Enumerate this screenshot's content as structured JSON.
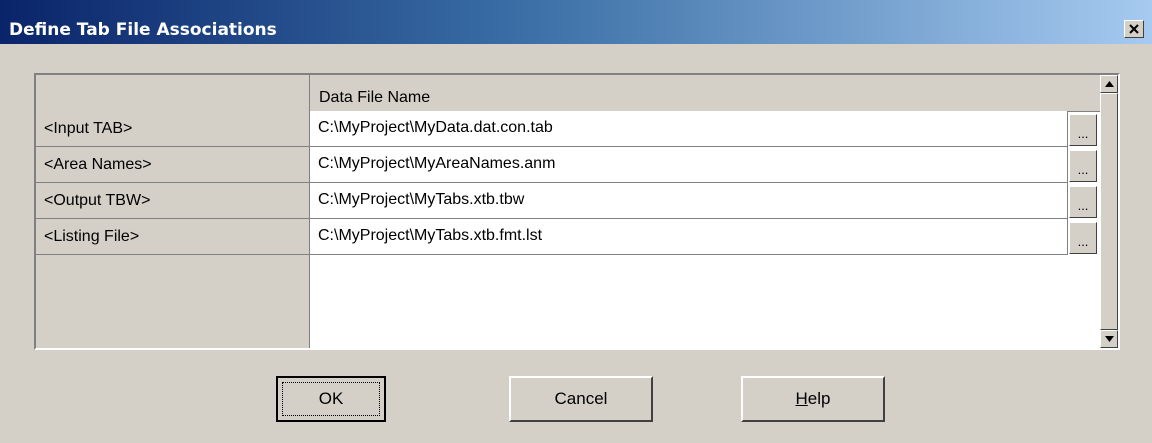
{
  "window": {
    "title": "Define Tab File Associations",
    "close_glyph": "✕",
    "close_icon": "close-icon"
  },
  "grid": {
    "column_header": "Data File Name",
    "browse_label": "...",
    "rows": [
      {
        "label": "<Input TAB>",
        "value": "C:\\MyProject\\MyData.dat.con.tab"
      },
      {
        "label": "<Area Names>",
        "value": "C:\\MyProject\\MyAreaNames.anm"
      },
      {
        "label": "<Output TBW>",
        "value": "C:\\MyProject\\MyTabs.xtb.tbw"
      },
      {
        "label": "<Listing File>",
        "value": "C:\\MyProject\\MyTabs.xtb.fmt.lst"
      }
    ]
  },
  "buttons": {
    "ok": "OK",
    "cancel": "Cancel",
    "help_mnemonic": "H",
    "help_rest": "elp"
  },
  "colors": {
    "titlebar_start": "#0a246a",
    "titlebar_end": "#a6caf0",
    "face": "#d4d0c8"
  }
}
